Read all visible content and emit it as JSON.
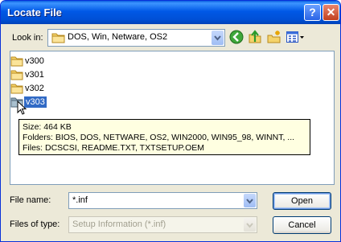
{
  "titlebar": {
    "title": "Locate File",
    "help_label": "?",
    "close_label": "✕"
  },
  "look_in": {
    "label": "Look in:",
    "value": "DOS, Win, Netware, OS2"
  },
  "toolbar": {
    "icons": [
      "back-icon",
      "up-folder-icon",
      "new-folder-icon",
      "view-menu-icon"
    ]
  },
  "files": [
    {
      "name": "v300"
    },
    {
      "name": "v301"
    },
    {
      "name": "v302"
    },
    {
      "name": "v303"
    }
  ],
  "tooltip": {
    "size": "Size: 464 KB",
    "folders": "Folders: BIOS, DOS, NETWARE, OS2, WIN2000, WIN95_98, WINNT, ...",
    "files": "Files: DCSCSI, README.TXT, TXTSETUP.OEM"
  },
  "file_name": {
    "label": "File name:",
    "value": "*.inf"
  },
  "files_of_type": {
    "label": "Files of type:",
    "value": "Setup Information (*.inf)"
  },
  "buttons": {
    "open": "Open",
    "cancel": "Cancel"
  },
  "colors": {
    "title_bar": "#0058e6",
    "selection": "#316ac5",
    "tooltip_bg": "#ffffe1",
    "dialog_bg": "#ece9d8"
  }
}
